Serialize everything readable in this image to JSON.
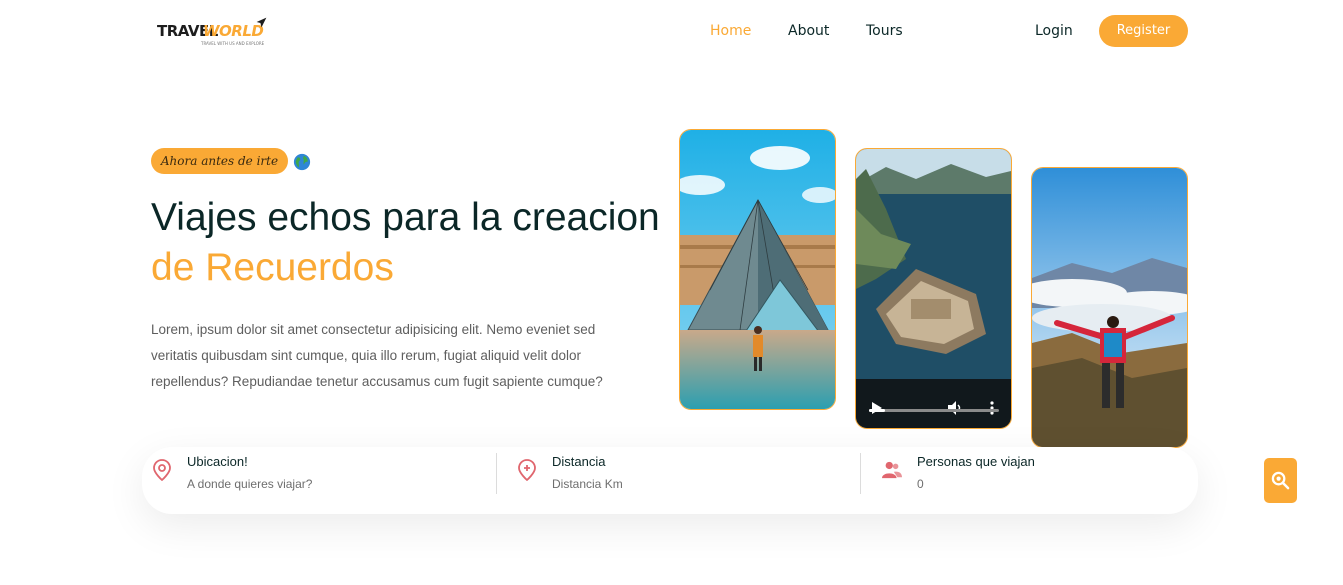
{
  "brand": {
    "word1": "TRAVEL",
    "word2": "WORLD",
    "tagline": "TRAVEL WITH US AND EXPLORE",
    "accent": "#faa935",
    "dark": "#0b2727"
  },
  "nav": {
    "items": [
      {
        "label": "Home",
        "active": true
      },
      {
        "label": "About",
        "active": false
      },
      {
        "label": "Tours",
        "active": false
      }
    ],
    "login_label": "Login",
    "register_label": "Register"
  },
  "hero": {
    "subtitle": "Ahora antes de irte",
    "subtitle_icon": "globe-icon",
    "headline_part1": "Viajes echos para la creacion ",
    "headline_highlight": "de Recuerdos",
    "lead": "Lorem, ipsum dolor sit amet consectetur adipisicing elit. Nemo eveniet sed veritatis quibusdam sint cumque, quia illo rerum, fugiat aliquid velit dolor repellendus? Repudiandae tenetur accusamus cum fugit sapiente cumque?"
  },
  "media": {
    "images": [
      "louvre-pyramid-photo",
      "island-fort-video",
      "mountain-hiker-photo"
    ],
    "video": {
      "progress_fraction": 0.12,
      "controls": [
        "play-icon",
        "volume-icon",
        "more-icon"
      ]
    }
  },
  "search": {
    "fields": [
      {
        "title": "Ubicacion!",
        "placeholder": "A donde quieres viajar?",
        "icon": "location-pin-icon"
      },
      {
        "title": "Distancia",
        "placeholder": "Distancia Km",
        "icon": "distance-pin-icon"
      },
      {
        "title": "Personas que viajan",
        "placeholder": "0",
        "icon": "people-icon"
      }
    ],
    "button_icon": "search-icon"
  }
}
